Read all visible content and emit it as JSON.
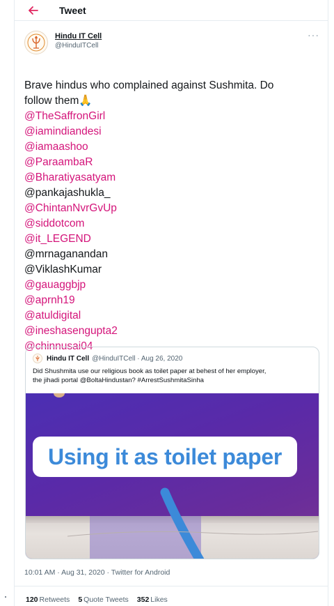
{
  "header": {
    "title": "Tweet"
  },
  "author": {
    "name": "Hindu IT Cell",
    "handle": "@HinduITCell"
  },
  "tweet": {
    "intro_line1": "Brave hindus who complained against Sushmita. Do",
    "intro_line2": "follow them",
    "emoji": "🙏",
    "mentions": [
      {
        "text": "@TheSaffronGirl",
        "linked": true
      },
      {
        "text": "@iamindiandesi",
        "linked": true
      },
      {
        "text": "@iamaashoo",
        "linked": true
      },
      {
        "text": "@ParaambaR",
        "linked": true
      },
      {
        "text": "@Bharatiyasatyam",
        "linked": true
      },
      {
        "text": "@pankajashukla_",
        "linked": false
      },
      {
        "text": "@ChintanNvrGvUp",
        "linked": true
      },
      {
        "text": "@siddotcom",
        "linked": true
      },
      {
        "text": "@it_LEGEND",
        "linked": true
      },
      {
        "text": "@mrnaganandan",
        "linked": false
      },
      {
        "text": "@ViklashKumar",
        "linked": false
      },
      {
        "text": "@gauaggbjp",
        "linked": true
      },
      {
        "text": "@aprnh19",
        "linked": true
      },
      {
        "text": "@atuldigital",
        "linked": true
      },
      {
        "text": "@ineshasengupta2",
        "linked": true
      },
      {
        "text": "@chinnusai04",
        "linked": true
      }
    ]
  },
  "quote": {
    "name": "Hindu IT Cell",
    "meta": "@HinduITCell · Aug 26, 2020",
    "text_line1": "Did Shushmita use our religious book as toilet paper at behest of her employer,",
    "text_line2": "the jihadi portal @BoltaHindustan? #ArrestSushmitaSinha",
    "media_caption": "Using it as toilet paper"
  },
  "meta": {
    "timestamp": "10:01 AM · Aug 31, 2020 · Twitter for Android"
  },
  "stats": {
    "retweets_count": "120",
    "retweets_label": "Retweets",
    "quotes_count": "5",
    "quotes_label": "Quote Tweets",
    "likes_count": "352",
    "likes_label": "Likes"
  },
  "colors": {
    "mention": "#d4147a",
    "back_arrow": "#e0245e",
    "banner_text": "#3c8ad9"
  }
}
